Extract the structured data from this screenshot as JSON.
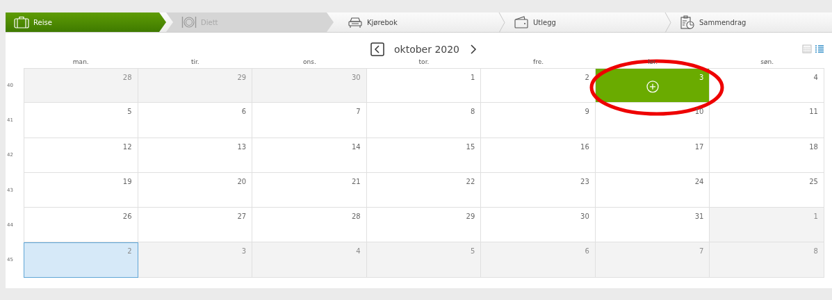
{
  "steps": [
    {
      "label": "Reise",
      "selected": true,
      "disabled": false
    },
    {
      "label": "Diett",
      "selected": false,
      "disabled": true
    },
    {
      "label": "Kjørebok",
      "selected": false,
      "disabled": false
    },
    {
      "label": "Utlegg",
      "selected": false,
      "disabled": false
    },
    {
      "label": "Sammendrag",
      "selected": false,
      "disabled": false
    }
  ],
  "calendar": {
    "month": "oktober 2020",
    "views": [
      {
        "kind": "calendar",
        "selected": false
      },
      {
        "kind": "list",
        "selected": true
      }
    ],
    "weekdays": [
      "man.",
      "tir.",
      "ons.",
      "tor.",
      "fre.",
      "lør.",
      "søn."
    ],
    "weeks": [
      {
        "number": "40",
        "days": [
          {
            "day": "28",
            "outside": true,
            "selected": false,
            "hovered": false
          },
          {
            "day": "29",
            "outside": true,
            "selected": false,
            "hovered": false
          },
          {
            "day": "30",
            "outside": true,
            "selected": false,
            "hovered": false
          },
          {
            "day": "1",
            "outside": false,
            "selected": false,
            "hovered": false
          },
          {
            "day": "2",
            "outside": false,
            "selected": false,
            "hovered": false
          },
          {
            "day": "3",
            "outside": false,
            "selected": false,
            "hovered": true
          },
          {
            "day": "4",
            "outside": false,
            "selected": false,
            "hovered": false
          }
        ]
      },
      {
        "number": "41",
        "days": [
          {
            "day": "5",
            "outside": false,
            "selected": false,
            "hovered": false
          },
          {
            "day": "6",
            "outside": false,
            "selected": false,
            "hovered": false
          },
          {
            "day": "7",
            "outside": false,
            "selected": false,
            "hovered": false
          },
          {
            "day": "8",
            "outside": false,
            "selected": false,
            "hovered": false
          },
          {
            "day": "9",
            "outside": false,
            "selected": false,
            "hovered": false
          },
          {
            "day": "10",
            "outside": false,
            "selected": false,
            "hovered": false
          },
          {
            "day": "11",
            "outside": false,
            "selected": false,
            "hovered": false
          }
        ]
      },
      {
        "number": "42",
        "days": [
          {
            "day": "12",
            "outside": false,
            "selected": false,
            "hovered": false
          },
          {
            "day": "13",
            "outside": false,
            "selected": false,
            "hovered": false
          },
          {
            "day": "14",
            "outside": false,
            "selected": false,
            "hovered": false
          },
          {
            "day": "15",
            "outside": false,
            "selected": false,
            "hovered": false
          },
          {
            "day": "16",
            "outside": false,
            "selected": false,
            "hovered": false
          },
          {
            "day": "17",
            "outside": false,
            "selected": false,
            "hovered": false
          },
          {
            "day": "18",
            "outside": false,
            "selected": false,
            "hovered": false
          }
        ]
      },
      {
        "number": "43",
        "days": [
          {
            "day": "19",
            "outside": false,
            "selected": false,
            "hovered": false
          },
          {
            "day": "20",
            "outside": false,
            "selected": false,
            "hovered": false
          },
          {
            "day": "21",
            "outside": false,
            "selected": false,
            "hovered": false
          },
          {
            "day": "22",
            "outside": false,
            "selected": false,
            "hovered": false
          },
          {
            "day": "23",
            "outside": false,
            "selected": false,
            "hovered": false
          },
          {
            "day": "24",
            "outside": false,
            "selected": false,
            "hovered": false
          },
          {
            "day": "25",
            "outside": false,
            "selected": false,
            "hovered": false
          }
        ]
      },
      {
        "number": "44",
        "days": [
          {
            "day": "26",
            "outside": false,
            "selected": false,
            "hovered": false
          },
          {
            "day": "27",
            "outside": false,
            "selected": false,
            "hovered": false
          },
          {
            "day": "28",
            "outside": false,
            "selected": false,
            "hovered": false
          },
          {
            "day": "29",
            "outside": false,
            "selected": false,
            "hovered": false
          },
          {
            "day": "30",
            "outside": false,
            "selected": false,
            "hovered": false
          },
          {
            "day": "31",
            "outside": false,
            "selected": false,
            "hovered": false
          },
          {
            "day": "1",
            "outside": true,
            "selected": false,
            "hovered": false
          }
        ]
      },
      {
        "number": "45",
        "days": [
          {
            "day": "2",
            "outside": true,
            "selected": true,
            "hovered": false
          },
          {
            "day": "3",
            "outside": true,
            "selected": false,
            "hovered": false
          },
          {
            "day": "4",
            "outside": true,
            "selected": false,
            "hovered": false
          },
          {
            "day": "5",
            "outside": true,
            "selected": false,
            "hovered": false
          },
          {
            "day": "6",
            "outside": true,
            "selected": false,
            "hovered": false
          },
          {
            "day": "7",
            "outside": true,
            "selected": false,
            "hovered": false
          },
          {
            "day": "8",
            "outside": true,
            "selected": false,
            "hovered": false
          }
        ]
      }
    ]
  }
}
